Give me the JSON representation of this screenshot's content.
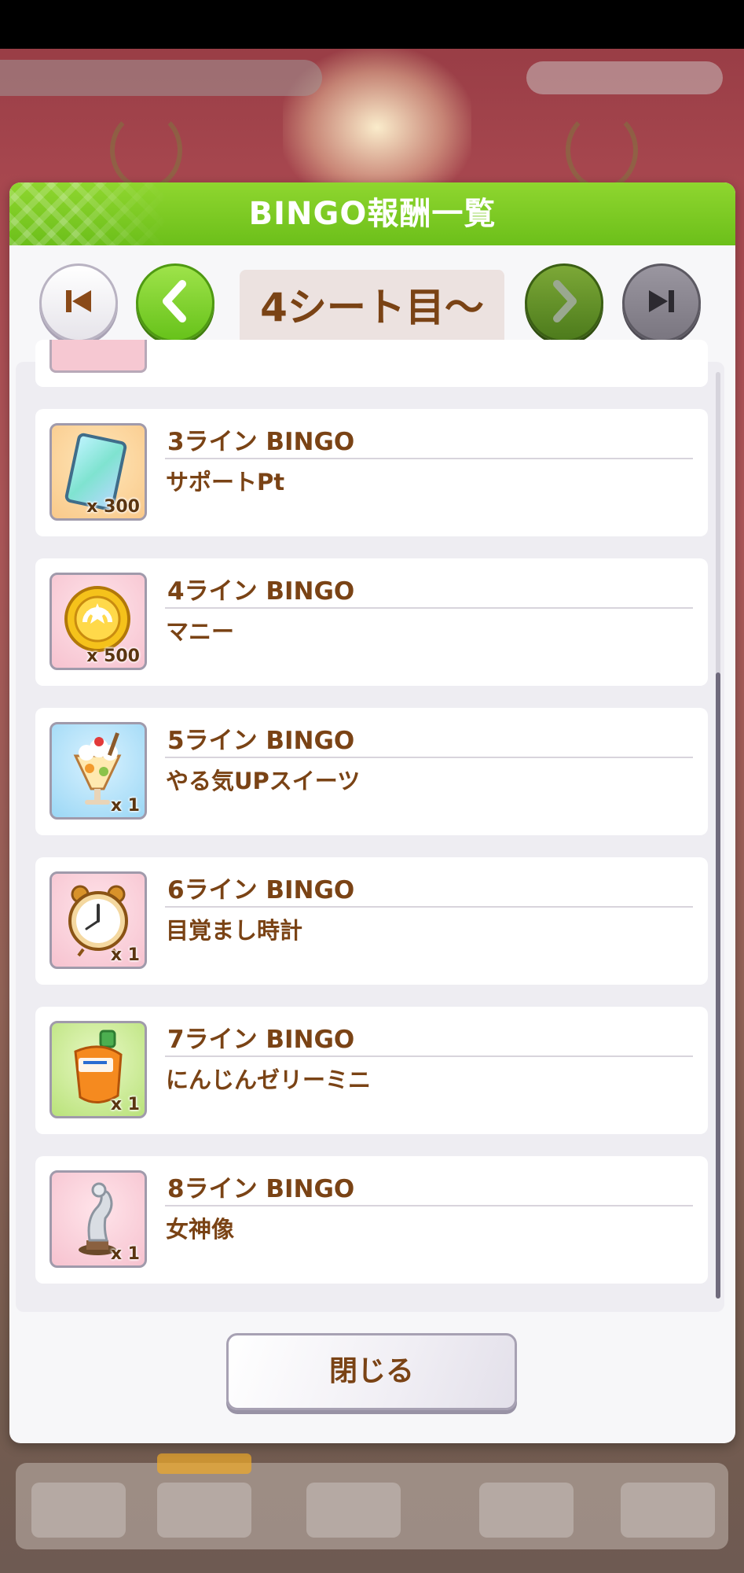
{
  "dialog": {
    "title": "BINGO報酬一覧",
    "sheet_label": "4シート目～",
    "close_label": "閉じる",
    "header_color": "#7dcb25",
    "text_color": "#7a4315"
  },
  "navigation": {
    "first_icon": "skip-first-icon",
    "prev_icon": "chevron-left-icon",
    "next_icon": "chevron-right-icon",
    "last_icon": "skip-last-icon"
  },
  "rewards": [
    {
      "title": "3ライン BINGO",
      "item": "サポートPt",
      "qty": "x 300",
      "icon": "support-pt-ticket-icon"
    },
    {
      "title": "4ライン BINGO",
      "item": "マニー",
      "qty": "x 500",
      "icon": "money-coin-icon"
    },
    {
      "title": "5ライン BINGO",
      "item": "やる気UPスイーツ",
      "qty": "x 1",
      "icon": "parfait-icon"
    },
    {
      "title": "6ライン BINGO",
      "item": "目覚まし時計",
      "qty": "x 1",
      "icon": "alarm-clock-icon"
    },
    {
      "title": "7ライン BINGO",
      "item": "にんじんゼリーミニ",
      "qty": "x 1",
      "icon": "carrot-jelly-icon"
    },
    {
      "title": "8ライン BINGO",
      "item": "女神像",
      "qty": "x 1",
      "icon": "goddess-statue-icon"
    }
  ]
}
